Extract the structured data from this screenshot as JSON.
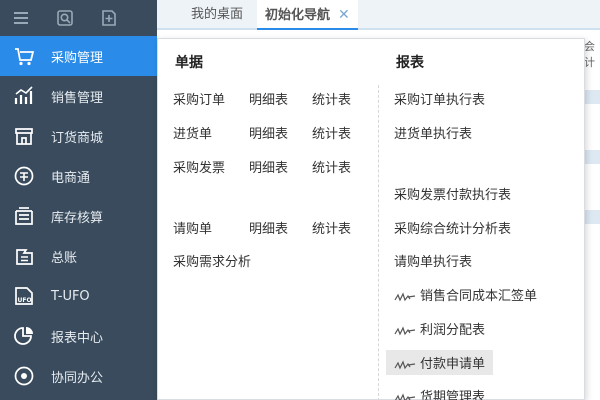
{
  "tabs": {
    "desktop": "我的桌面",
    "guide": "初始化导航",
    "close": "✕"
  },
  "sidebar": {
    "items": [
      {
        "label": "采购管理",
        "icon": "shopping-cart-icon",
        "active": true
      },
      {
        "label": "销售管理",
        "icon": "sales-chart-icon"
      },
      {
        "label": "订货商城",
        "icon": "store-icon"
      },
      {
        "label": "电商通",
        "icon": "ecommerce-icon"
      },
      {
        "label": "库存核算",
        "icon": "inventory-icon"
      },
      {
        "label": "总账",
        "icon": "ledger-icon"
      },
      {
        "label": "T-UFO",
        "icon": "ufo-icon"
      },
      {
        "label": "报表中心",
        "icon": "pie-chart-icon"
      },
      {
        "label": "协同办公",
        "icon": "collaboration-icon"
      }
    ]
  },
  "panel": {
    "documents_title": "单据",
    "reports_title": "报表",
    "documents": {
      "r1": [
        "采购订单",
        "明细表",
        "统计表"
      ],
      "r2": [
        "进货单",
        "明细表",
        "统计表"
      ],
      "r3": [
        "采购发票",
        "明细表",
        "统计表"
      ],
      "r4": [
        "请购单",
        "明细表",
        "统计表"
      ],
      "r5": "采购需求分析"
    },
    "reports": [
      "采购订单执行表",
      "进货单执行表",
      "采购发票付款执行表",
      "采购综合统计分析表",
      "请购单执行表",
      "销售合同成本汇签单",
      "利润分配表",
      "付款申请单",
      "货期管理表"
    ]
  },
  "edge": "会计",
  "colors": {
    "sidebar": "#394b5c",
    "accent": "#2b8be8"
  }
}
